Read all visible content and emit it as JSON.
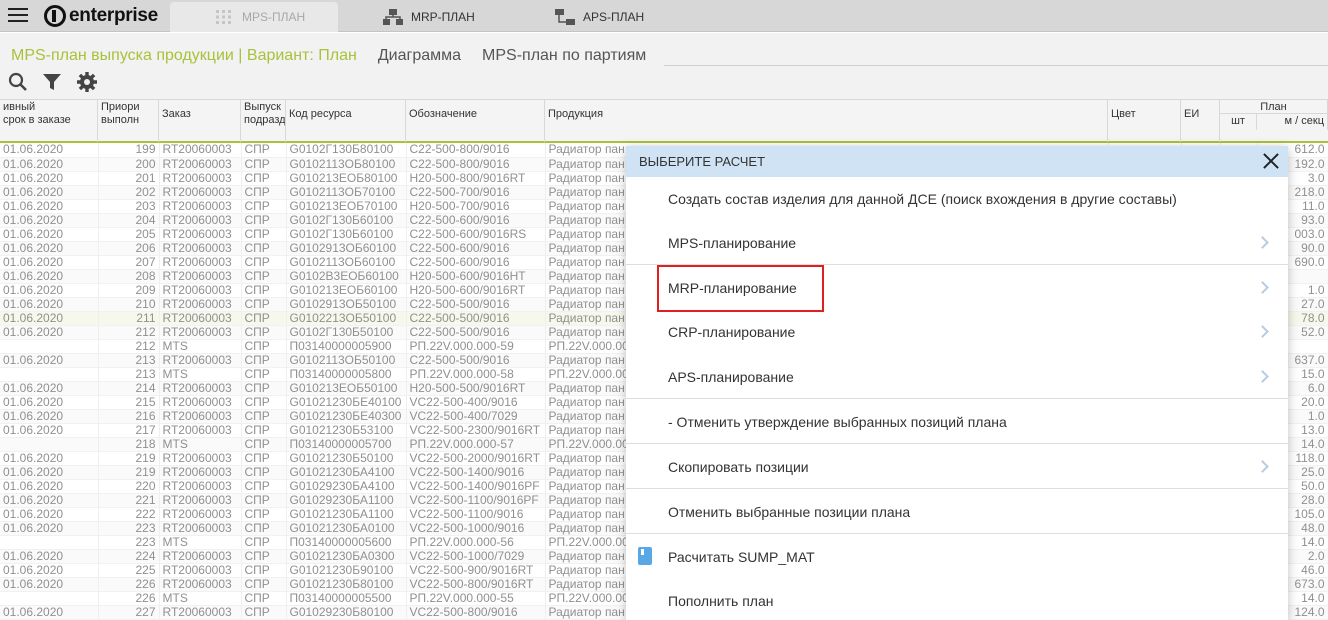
{
  "app": {
    "logo": "enterprise"
  },
  "top_tabs": [
    {
      "label": "MPS-ПЛАН",
      "icon": "grid-icon"
    },
    {
      "label": "MRP-ПЛАН",
      "icon": "network-icon"
    },
    {
      "label": "APS-ПЛАН",
      "icon": "network-icon"
    }
  ],
  "page_tabs": [
    "MPS-план выпуска продукции | Вариант: План",
    "Диаграмма",
    "MPS-план по партиям"
  ],
  "columns": {
    "c1": [
      "ивный",
      "срок в заказе"
    ],
    "c2": [
      "Приори",
      "выполн"
    ],
    "c3": "Заказ",
    "c4": [
      "Выпуск",
      "подразд"
    ],
    "c5": "Код ресурса",
    "c6": "Обозначение",
    "c7": "Продукция",
    "c8": "Цвет",
    "c9": "ЕИ",
    "c10": "План",
    "c10a": "шт",
    "c10b": "м / секц"
  },
  "rows": [
    [
      "01.06.2020",
      "199",
      "RT20060003",
      "СПР",
      "G0102Г130Б80100",
      "C22-500-800/9016",
      "Радиатор пан",
      "612.0"
    ],
    [
      "01.06.2020",
      "200",
      "RT20060003",
      "СПР",
      "G0102113ОБ80100",
      "C22-500-800/9016",
      "Радиатор пан",
      "192.0"
    ],
    [
      "01.06.2020",
      "201",
      "RT20060003",
      "СПР",
      "G010213ЕОБ80100",
      "H20-500-800/9016RT",
      "Радиатор пан",
      "3.0"
    ],
    [
      "01.06.2020",
      "202",
      "RT20060003",
      "СПР",
      "G0102113ОБ70100",
      "C22-500-700/9016",
      "Радиатор пан",
      "218.0"
    ],
    [
      "01.06.2020",
      "203",
      "RT20060003",
      "СПР",
      "G010213ЕОБ70100",
      "H20-500-700/9016",
      "Радиатор пан",
      "11.0"
    ],
    [
      "01.06.2020",
      "204",
      "RT20060003",
      "СПР",
      "G0102Г130Б60100",
      "C22-500-600/9016",
      "Радиатор пан",
      "93.0"
    ],
    [
      "01.06.2020",
      "205",
      "RT20060003",
      "СПР",
      "G0102Г130Б60100",
      "C22-500-600/9016RS",
      "Радиатор пан",
      "003.0"
    ],
    [
      "01.06.2020",
      "206",
      "RT20060003",
      "СПР",
      "G0102913ОБ60100",
      "C22-500-600/9016",
      "Радиатор пан",
      "90.0"
    ],
    [
      "01.06.2020",
      "207",
      "RT20060003",
      "СПР",
      "G0102113ОБ60100",
      "C22-500-600/9016",
      "Радиатор пан",
      "690.0"
    ],
    [
      "01.06.2020",
      "208",
      "RT20060003",
      "СПР",
      "G0102B3ЕОБ60100",
      "H20-500-600/9016HT",
      "Радиатор пан",
      ""
    ],
    [
      "01.06.2020",
      "209",
      "RT20060003",
      "СПР",
      "G010213ЕОБ60100",
      "H20-500-600/9016RT",
      "Радиатор пан",
      "1.0"
    ],
    [
      "01.06.2020",
      "210",
      "RT20060003",
      "СПР",
      "G0102913ОБ50100",
      "C22-500-500/9016",
      "Радиатор пан",
      "27.0"
    ],
    [
      "01.06.2020",
      "211",
      "RT20060003",
      "СПР",
      "G0102213ОБ50100",
      "C22-500-500/9016",
      "Радиатор пан",
      "78.0"
    ],
    [
      "01.06.2020",
      "212",
      "RT20060003",
      "СПР",
      "G0102Г130Б50100",
      "C22-500-500/9016",
      "Радиатор пан",
      "52.0"
    ],
    [
      "",
      "212",
      "MTS",
      "СПР",
      "П03140000005900",
      "РП.22V.000.000-59",
      "РП.22V.000.00",
      ""
    ],
    [
      "01.06.2020",
      "213",
      "RT20060003",
      "СПР",
      "G0102113ОБ50100",
      "C22-500-500/9016",
      "Радиатор пан",
      "637.0"
    ],
    [
      "",
      "213",
      "MTS",
      "СПР",
      "П03140000005800",
      "РП.22V.000.000-58",
      "РП.22V.000.00",
      "15.0"
    ],
    [
      "01.06.2020",
      "214",
      "RT20060003",
      "СПР",
      "G010213ЕОБ50100",
      "H20-500-500/9016RT",
      "Радиатор пан",
      "6.0"
    ],
    [
      "01.06.2020",
      "215",
      "RT20060003",
      "СПР",
      "G01021230БЕ40100",
      "VC22-500-400/9016",
      "Радиатор пан",
      "20.0"
    ],
    [
      "01.06.2020",
      "216",
      "RT20060003",
      "СПР",
      "G01021230БЕ40300",
      "VC22-500-400/7029",
      "Радиатор пан",
      "1.0"
    ],
    [
      "01.06.2020",
      "217",
      "RT20060003",
      "СПР",
      "G01021230Б53100",
      "VC22-500-2300/9016RT",
      "Радиатор пан",
      "13.0"
    ],
    [
      "",
      "218",
      "MTS",
      "СПР",
      "П03140000005700",
      "РП.22V.000.000-57",
      "РП.22V.000.00",
      "14.0"
    ],
    [
      "01.06.2020",
      "219",
      "RT20060003",
      "СПР",
      "G01021230Б50100",
      "VC22-500-2000/9016RT",
      "Радиатор пан",
      "118.0"
    ],
    [
      "01.06.2020",
      "219",
      "RT20060003",
      "СПР",
      "G01021230БА4100",
      "VC22-500-1400/9016",
      "Радиатор пан",
      "25.0"
    ],
    [
      "01.06.2020",
      "220",
      "RT20060003",
      "СПР",
      "G01029230БА4100",
      "VC22-500-1400/9016PF",
      "Радиатор пан",
      "50.0"
    ],
    [
      "01.06.2020",
      "221",
      "RT20060003",
      "СПР",
      "G01029230БА1100",
      "VC22-500-1100/9016PF",
      "Радиатор пан",
      "28.0"
    ],
    [
      "01.06.2020",
      "222",
      "RT20060003",
      "СПР",
      "G01021230БА1100",
      "VC22-500-1100/9016",
      "Радиатор пан",
      "105.0"
    ],
    [
      "01.06.2020",
      "223",
      "RT20060003",
      "СПР",
      "G01021230БА0100",
      "VC22-500-1000/9016",
      "Радиатор пан",
      "48.0"
    ],
    [
      "",
      "223",
      "MTS",
      "СПР",
      "П03140000005600",
      "РП.22V.000.000-56",
      "РП.22V.000.00",
      "14.0"
    ],
    [
      "01.06.2020",
      "224",
      "RT20060003",
      "СПР",
      "G01021230БА0300",
      "VC22-500-1000/7029",
      "Радиатор пан",
      "2.0"
    ],
    [
      "01.06.2020",
      "225",
      "RT20060003",
      "СПР",
      "G01021230Б90100",
      "VC22-500-900/9016RT",
      "Радиатор пан",
      "46.0"
    ],
    [
      "01.06.2020",
      "226",
      "RT20060003",
      "СПР",
      "G01021230Б80100",
      "VC22-500-800/9016RT",
      "Радиатор пан",
      "673.0"
    ],
    [
      "",
      "226",
      "MTS",
      "СПР",
      "П03140000005500",
      "РП.22V.000.000-55",
      "РП.22V.000.00",
      "14.0"
    ],
    [
      "01.06.2020",
      "227",
      "RT20060003",
      "СПР",
      "G01029230Б80100",
      "VC22-500-800/9016",
      "Радиатор пан",
      "124.0"
    ]
  ],
  "dialog": {
    "title": "ВЫБЕРИТЕ РАСЧЕТ",
    "items": [
      {
        "label": "Создать состав изделия для данной ДСЕ (поиск вхождения в другие составы)",
        "chevron": false
      },
      {
        "label": "MPS-планирование",
        "chevron": true
      },
      {
        "label": "MRP-планирование",
        "chevron": true
      },
      {
        "label": "CRP-планирование",
        "chevron": true
      },
      {
        "label": "APS-планирование",
        "chevron": true
      },
      {
        "label": "- Отменить утверждение выбранных позиций плана",
        "chevron": false
      },
      {
        "label": "Скопировать позиции",
        "chevron": true
      },
      {
        "label": "Отменить выбранные позиции плана",
        "chevron": false
      },
      {
        "label": "Расчитать SUMP_MAT",
        "chevron": false,
        "icon": "book-icon"
      },
      {
        "label": "Пополнить план",
        "chevron": false
      }
    ]
  },
  "colors": {
    "accent_green": "#a8c23a",
    "dialog_header": "#cfe3f5",
    "highlight": "#e02020"
  }
}
